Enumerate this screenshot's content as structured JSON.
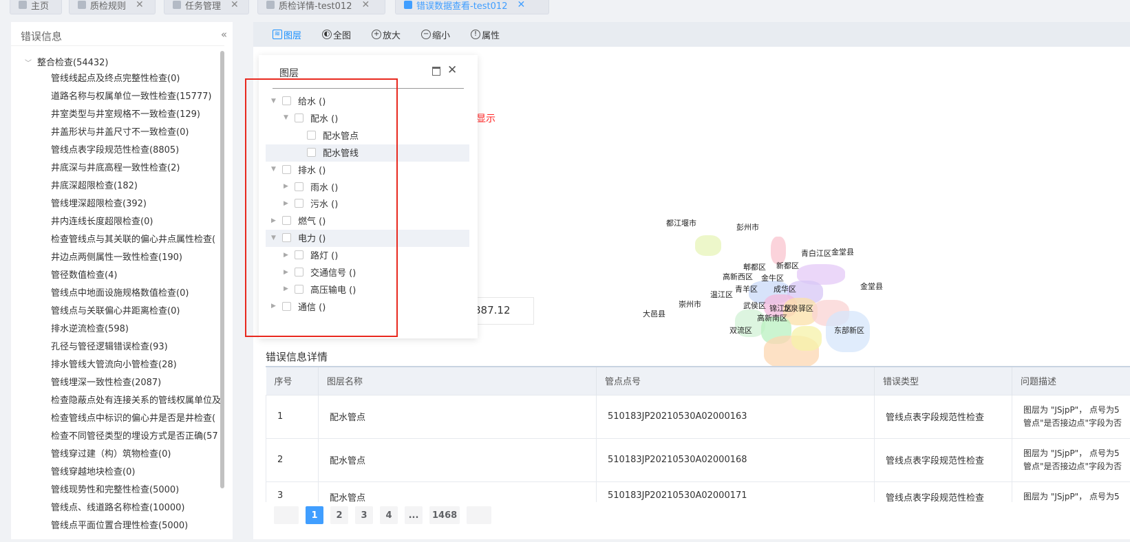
{
  "tabs": [
    {
      "label": "主页",
      "closable": false,
      "active": false
    },
    {
      "label": "质检规则",
      "closable": true,
      "active": false
    },
    {
      "label": "任务管理",
      "closable": true,
      "active": false
    },
    {
      "label": "质检详情-test012",
      "closable": true,
      "active": false
    },
    {
      "label": "错误数据查看-test012",
      "closable": true,
      "active": true
    }
  ],
  "sidebar": {
    "title": "错误信息",
    "collapse_icon": "double-chevron-left-icon",
    "root": "整合检查(54432)",
    "items": [
      "管线线起点及终点完整性检查(0)",
      "道路名称与权属单位一致性检查(15777)",
      "井室类型与井室规格不一致检查(129)",
      "井盖形状与井盖尺寸不一致检查(0)",
      "管线点表字段规范性检查(8805)",
      "井底深与井底高程一致性检查(2)",
      "井底深超限检查(182)",
      "管线埋深超限检查(392)",
      "井内连线长度超限检查(0)",
      "检查管线点与其关联的偏心井点属性检查(",
      "井边点两侧属性一致性检查(190)",
      "管径数值检查(4)",
      "管线点中地面设施规格数值检查(0)",
      "管线点与关联偏心井距离检查(0)",
      "排水逆流检查(598)",
      "孔径与管径逻辑错误检查(93)",
      "排水管线大管流向小管检查(28)",
      "管线埋深一致性检查(2087)",
      "检查隐蔽点处有连接关系的管线权属单位及",
      "检查管线点中标识的偏心井是否是井检查(",
      "检查不同管径类型的埋设方式是否正确(57",
      "管线穿过建（构）筑物检查(0)",
      "管线穿越地块检查(0)",
      "管线现势性和完整性检查(5000)",
      "管线点、线道路名称检查(10000)",
      "管线点平面位置合理性检查(5000)"
    ]
  },
  "toolbar": {
    "layers": "图层",
    "fullview": "全图",
    "zoom_in": "放大",
    "zoom_out": "缩小",
    "properties": "属性"
  },
  "layer_panel": {
    "title": "图层",
    "nodes": [
      {
        "label": "给水 ()",
        "level": 0,
        "arrow": "▼"
      },
      {
        "label": "配水 ()",
        "level": 1,
        "arrow": "▼"
      },
      {
        "label": "配水管点",
        "level": 2,
        "arrow": ""
      },
      {
        "label": "配水管线",
        "level": 2,
        "arrow": ""
      },
      {
        "label": "排水 ()",
        "level": 0,
        "arrow": "▼"
      },
      {
        "label": "雨水 ()",
        "level": 1,
        "arrow": "▶"
      },
      {
        "label": "污水 ()",
        "level": 1,
        "arrow": "▶"
      },
      {
        "label": "燃气 ()",
        "level": 0,
        "arrow": "▶"
      },
      {
        "label": "电力 ()",
        "level": 0,
        "arrow": "▼"
      },
      {
        "label": "路灯 ()",
        "level": 1,
        "arrow": "▶"
      },
      {
        "label": "交通信号 ()",
        "level": 1,
        "arrow": "▶"
      },
      {
        "label": "高压输电 ()",
        "level": 1,
        "arrow": "▶"
      },
      {
        "label": "通信 ()",
        "level": 0,
        "arrow": "▶"
      }
    ]
  },
  "annotation": "图层数量没显示",
  "coordinate": "887.12",
  "map_labels": [
    "都江堰市",
    "彭州市",
    "青白江区",
    "金堂县",
    "郫都区",
    "新都区",
    "高新西区",
    "金牛区",
    "金堂县",
    "温江区",
    "青羊区",
    "成华区",
    "崇州市",
    "武侯区",
    "锦江区",
    "龙泉驿区",
    "大邑县",
    "高新南区",
    "双流区",
    "东部新区"
  ],
  "detail": {
    "title": "错误信息详情",
    "columns": [
      "序号",
      "图层名称",
      "管点点号",
      "错误类型",
      "问题描述"
    ],
    "rows": [
      {
        "no": "1",
        "layer": "配水管点",
        "id": "510183JP20210530A02000163",
        "type": "管线点表字段规范性检查",
        "desc1": "图层为 \"JSjpP\"， 点号为5",
        "desc2": "管点\"是否接边点\"字段为否"
      },
      {
        "no": "2",
        "layer": "配水管点",
        "id": "510183JP20210530A02000168",
        "type": "管线点表字段规范性检查",
        "desc1": "图层为 \"JSjpP\"， 点号为5",
        "desc2": "管点\"是否接边点\"字段为否"
      },
      {
        "no": "3",
        "layer": "配水管点",
        "id": "510183JP20210530A02000171",
        "type": "管线点表字段规范性检查",
        "desc1": "图层为 \"JSjpP\"， 点号为5",
        "desc2": ""
      }
    ]
  },
  "pagination": {
    "pages": [
      "1",
      "2",
      "3",
      "4",
      "...",
      "1468"
    ],
    "current": "1"
  }
}
